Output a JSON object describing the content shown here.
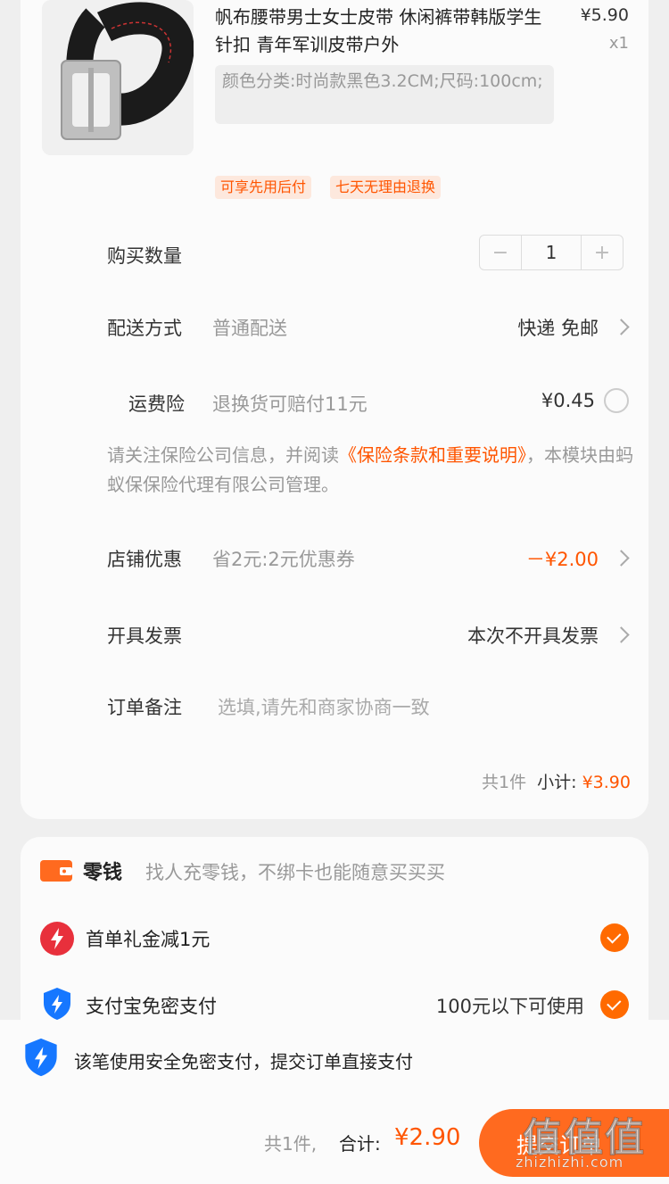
{
  "product": {
    "title": "帆布腰带男士女士皮带 休闲裤带韩版学生针扣 青年军训皮带户外",
    "price": "¥5.90",
    "quantity_label": "x1",
    "sku": "颜色分类:时尚款黑色3.2CM;尺码:100cm;",
    "tags": [
      "可享先用后付",
      "七天无理由退换"
    ]
  },
  "quantity_row": {
    "label": "购买数量",
    "value": "1",
    "minus": "−",
    "plus": "+"
  },
  "delivery_row": {
    "label": "配送方式",
    "sub": "普通配送",
    "value": "快递 免邮"
  },
  "insurance_row": {
    "label": "运费险",
    "sub": "退换货可赔付11元",
    "value": "¥0.45",
    "notice_pre": "请关注保险公司信息，并阅读",
    "notice_link": "《保险条款和重要说明》",
    "notice_post": "，本模块由蚂蚁保保险代理有限公司管理。"
  },
  "coupon_row": {
    "label": "店铺优惠",
    "sub": "省2元:2元优惠券",
    "value": "－¥2.00"
  },
  "invoice_row": {
    "label": "开具发票",
    "value": "本次不开具发票"
  },
  "remark_row": {
    "label": "订单备注",
    "placeholder": "选填,请先和商家协商一致"
  },
  "subtotal": {
    "count": "共1件",
    "label": "小计:",
    "amount": "¥3.90"
  },
  "payment": {
    "wallet_title": "零钱",
    "wallet_sub": "找人充零钱，不绑卡也能随意买买买",
    "gift_label": "首单礼金减1元",
    "alipay_label": "支付宝免密支付",
    "alipay_note": "100元以下可使用"
  },
  "bottom": {
    "secure_text": "该笔使用安全免密支付，提交订单直接支付",
    "count": "共1件,",
    "total_label": "合计:",
    "total_amount": "¥2.90",
    "submit_label": "提交订单",
    "watermark": "值值值",
    "watermark_url": "zhizhizhi.com"
  },
  "colors": {
    "accent": "#ff5500",
    "button": "#ff6a1f",
    "shield": "#1677ff",
    "gift": "#e8303c",
    "wallet": "#ff6a1f"
  },
  "icons": [
    "belt-product-image",
    "chevron-right-icon",
    "wallet-icon",
    "gift-lightning-icon",
    "shield-lightning-icon",
    "checkmark-icon"
  ]
}
